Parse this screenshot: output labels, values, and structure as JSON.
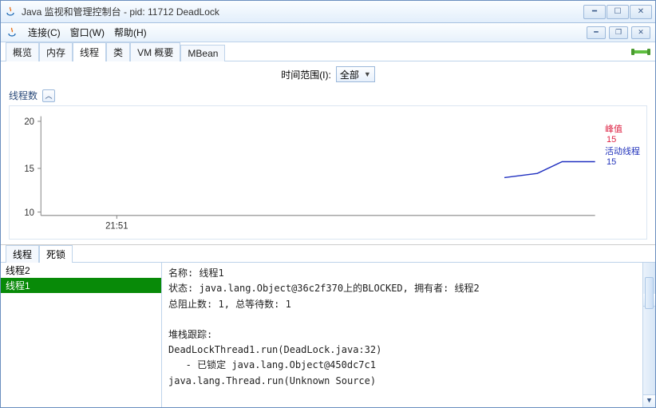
{
  "window": {
    "title": "Java 监视和管理控制台 - pid: 11712 DeadLock"
  },
  "menubar": {
    "connect": "连接(C)",
    "window": "窗口(W)",
    "help": "帮助(H)"
  },
  "tabs": {
    "overview": "概览",
    "memory": "内存",
    "threads": "线程",
    "classes": "类",
    "vmsum": "VM 概要",
    "mbean": "MBean"
  },
  "range": {
    "label": "时间范围(I):",
    "value": "全部"
  },
  "section": {
    "title": "线程数"
  },
  "chart_legend": {
    "peak_label": "峰值",
    "peak_value": "15",
    "live_label": "活动线程",
    "live_value": "15"
  },
  "chart_data": {
    "type": "line",
    "title": "线程数",
    "xlabel": "",
    "ylabel": "",
    "ylim": [
      10,
      20
    ],
    "yticks": [
      10,
      15,
      20
    ],
    "xticks": [
      "21:51"
    ],
    "series": [
      {
        "name": "活动线程",
        "values": [
          14,
          14,
          15,
          15
        ]
      }
    ]
  },
  "bottom_tabs": {
    "threads": "线程",
    "deadlock": "死锁"
  },
  "thread_list": {
    "items": [
      {
        "id": "t2",
        "label": "线程2",
        "selected": false
      },
      {
        "id": "t1",
        "label": "线程1",
        "selected": true
      }
    ]
  },
  "detail": {
    "name_label": "名称:",
    "name_value": "线程1",
    "state_label": "状态:",
    "state_value": "java.lang.Object@36c2f370上的BLOCKED, 拥有者: 线程2",
    "blocked_label": "总阻止数:",
    "blocked_value": "1,",
    "waited_label": "总等待数:",
    "waited_value": "1",
    "trace_label": "堆栈跟踪:",
    "trace_line1": "DeadLockThread1.run(DeadLock.java:32)",
    "trace_line2": "   - 已锁定 java.lang.Object@450dc7c1",
    "trace_line3": "java.lang.Thread.run(Unknown Source)"
  }
}
